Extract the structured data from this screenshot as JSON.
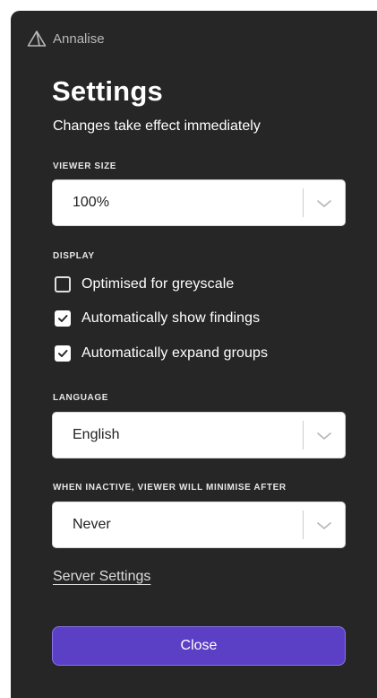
{
  "brand": {
    "name": "Annalise",
    "icon": "annalise-logo-icon"
  },
  "settings": {
    "title": "Settings",
    "subtitle": "Changes take effect immediately"
  },
  "viewer_size": {
    "label": "VIEWER SIZE",
    "value": "100%"
  },
  "display": {
    "label": "DISPLAY",
    "options": [
      {
        "label": "Optimised for greyscale",
        "checked": false
      },
      {
        "label": "Automatically show findings",
        "checked": true
      },
      {
        "label": "Automatically expand groups",
        "checked": true
      }
    ]
  },
  "language": {
    "label": "LANGUAGE",
    "value": "English"
  },
  "inactive": {
    "label": "WHEN INACTIVE, VIEWER WILL MINIMISE AFTER",
    "value": "Never"
  },
  "links": {
    "server_settings": "Server Settings"
  },
  "actions": {
    "close_label": "Close"
  },
  "colors": {
    "panel_bg": "#262626",
    "accent": "#5b3fc4",
    "accent_border": "#8a72e6"
  }
}
